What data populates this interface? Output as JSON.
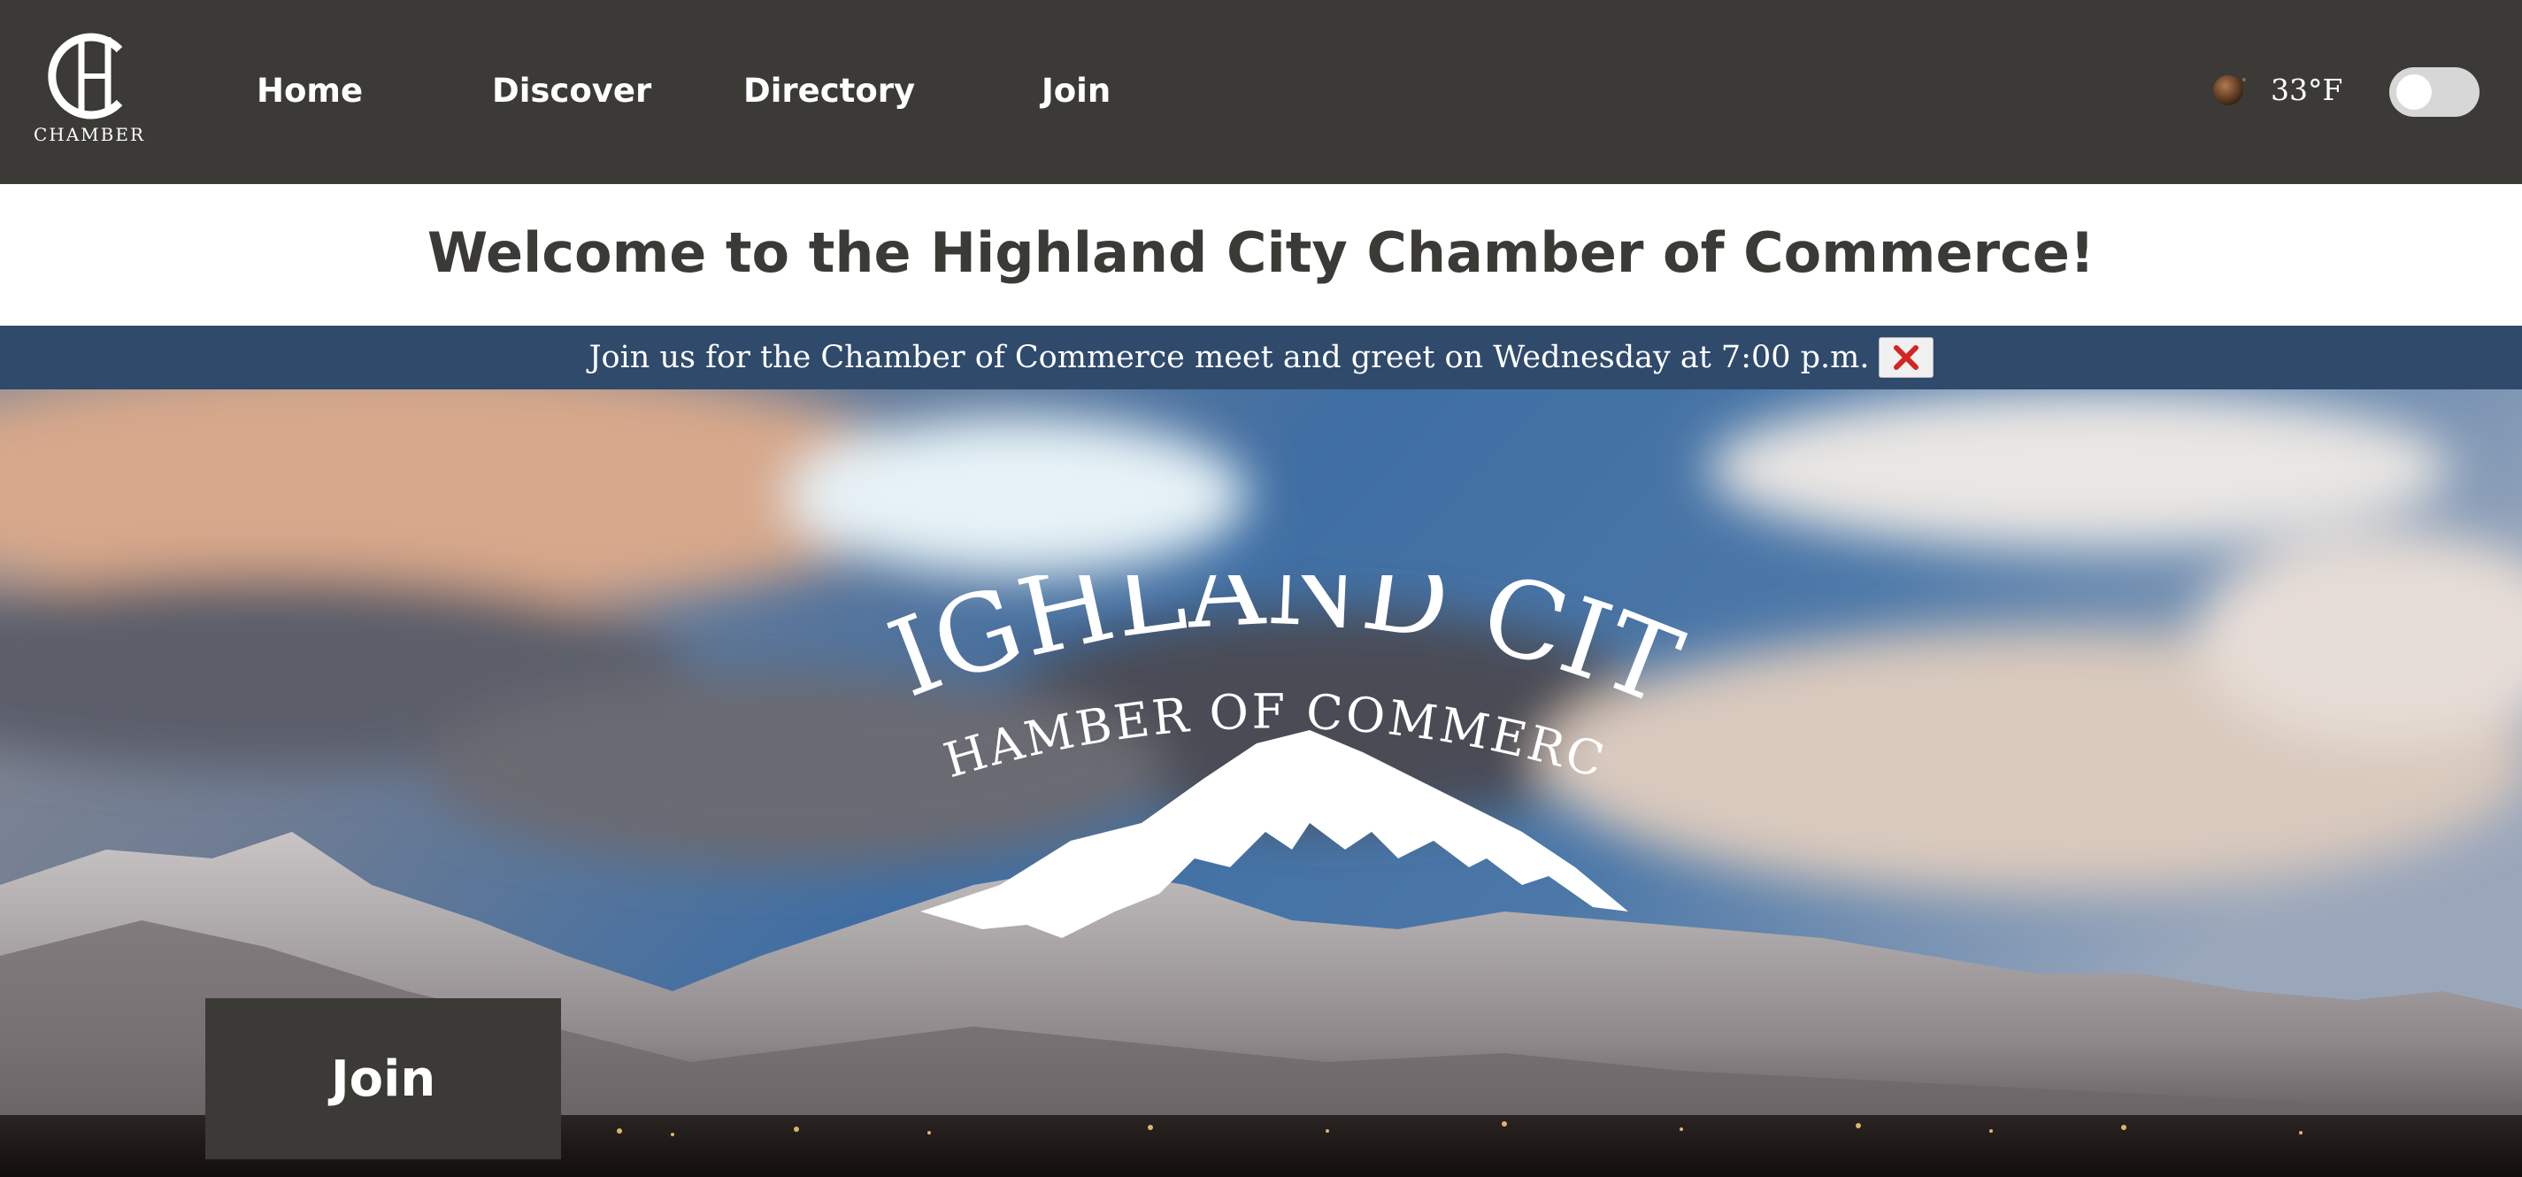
{
  "header": {
    "logo": {
      "monogram": "HC",
      "word": "CHAMBER"
    },
    "nav": [
      {
        "label": "Home"
      },
      {
        "label": "Discover"
      },
      {
        "label": "Directory"
      },
      {
        "label": "Join"
      }
    ],
    "weather": {
      "icon": "weather-condition-icon",
      "temperature": "33°F"
    },
    "dark_mode_toggle": {
      "on": false
    }
  },
  "welcome": {
    "title": "Welcome to the Highland City Chamber of Commerce!"
  },
  "banner": {
    "message": "Join us for the Chamber of Commerce meet and greet on Wednesday at 7:00 p.m.",
    "close_icon": "close-icon"
  },
  "hero": {
    "logo_title": "HIGHLAND CITY",
    "logo_subtitle": "CHAMBER OF COMMERCE",
    "join_label": "Join"
  },
  "colors": {
    "header_bg": "#3b3a36",
    "banner_bg": "#2f4a6b",
    "close_red": "#d42424",
    "text_dark": "#3b3a36"
  }
}
